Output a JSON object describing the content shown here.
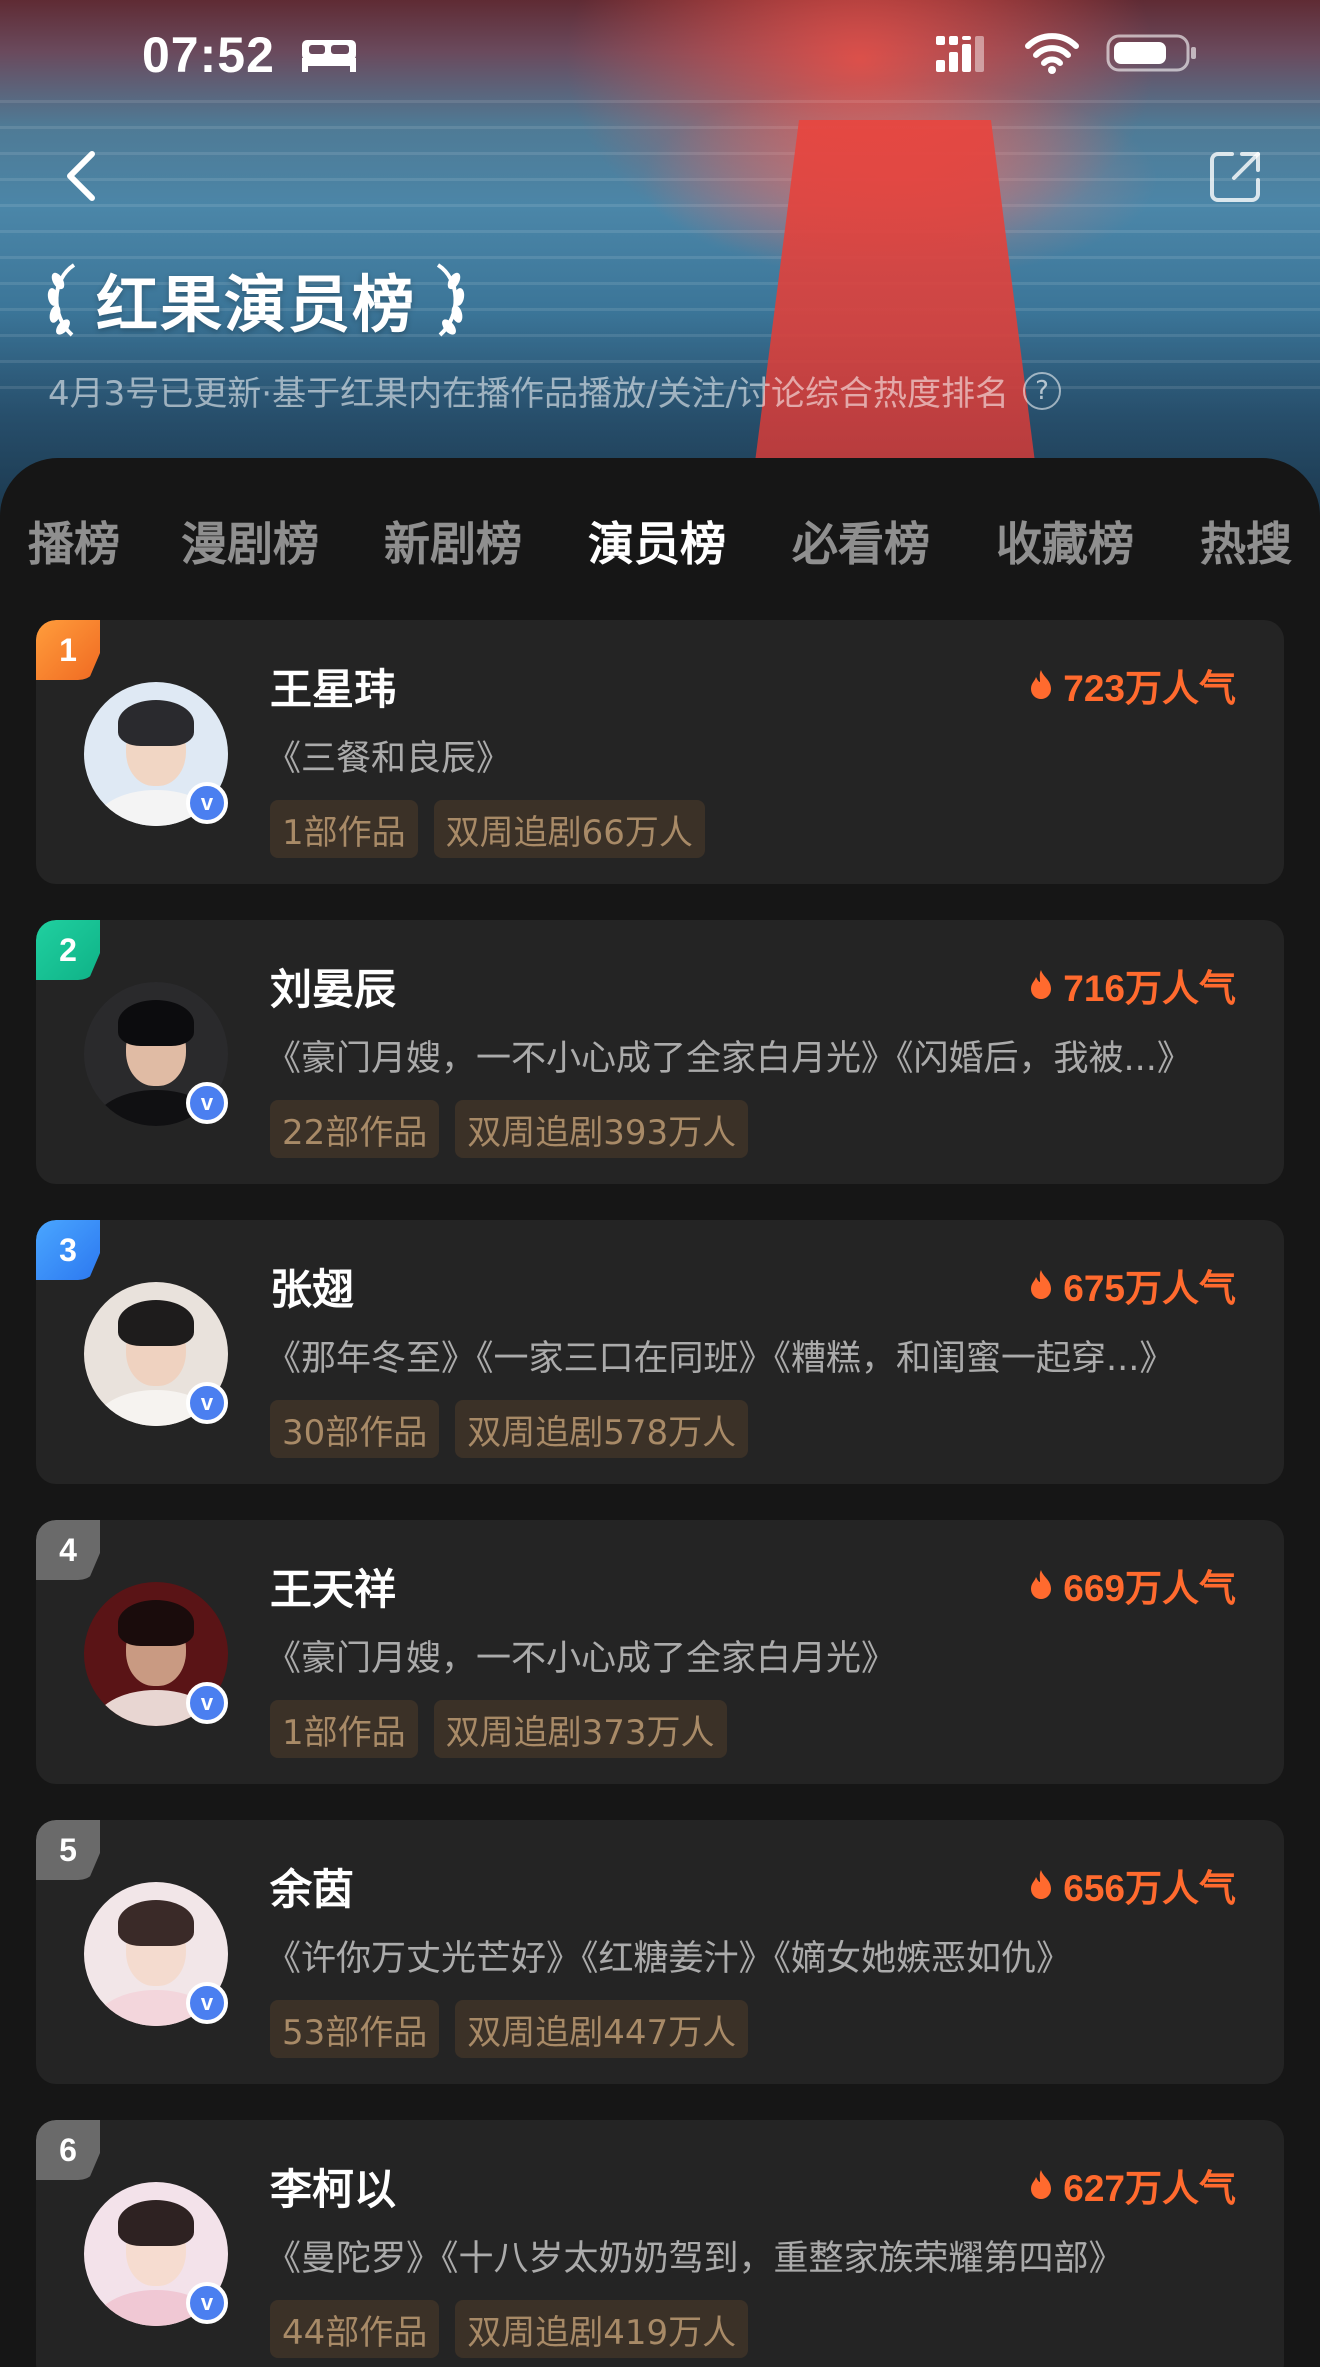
{
  "status_bar": {
    "time": "07:52"
  },
  "header": {
    "title": "红果演员榜",
    "subtitle": "4月3号已更新·基于红果内在播作品播放/关注/讨论综合热度排名",
    "help_label": "?"
  },
  "tabs": [
    {
      "label": "播榜",
      "active": false
    },
    {
      "label": "漫剧榜",
      "active": false
    },
    {
      "label": "新剧榜",
      "active": false
    },
    {
      "label": "演员榜",
      "active": true
    },
    {
      "label": "必看榜",
      "active": false
    },
    {
      "label": "收藏榜",
      "active": false
    },
    {
      "label": "热搜",
      "active": false
    }
  ],
  "verify_mark": "v",
  "colors": {
    "accent_heat": "#ff6a2e",
    "rank_1": "#f06a22",
    "rank_2": "#0fb287",
    "rank_3": "#2c78f0",
    "rank_other": "#6a6a6a",
    "tag_bg": "#3b3127",
    "tag_text": "#a88a67",
    "card_bg": "#242424",
    "page_bg": "#161616"
  },
  "actors": [
    {
      "rank": "1",
      "name": "王星玮",
      "heat": "723万人气",
      "works": "《三餐和良辰》",
      "tags": [
        "1部作品",
        "双周追剧66万人"
      ]
    },
    {
      "rank": "2",
      "name": "刘晏辰",
      "heat": "716万人气",
      "works": "《豪门月嫂，一不小心成了全家白月光》《闪婚后，我被...》",
      "tags": [
        "22部作品",
        "双周追剧393万人"
      ]
    },
    {
      "rank": "3",
      "name": "张翅",
      "heat": "675万人气",
      "works": "《那年冬至》《一家三口在同班》《糟糕，和闺蜜一起穿...》",
      "tags": [
        "30部作品",
        "双周追剧578万人"
      ]
    },
    {
      "rank": "4",
      "name": "王天祥",
      "heat": "669万人气",
      "works": "《豪门月嫂，一不小心成了全家白月光》",
      "tags": [
        "1部作品",
        "双周追剧373万人"
      ]
    },
    {
      "rank": "5",
      "name": "余茵",
      "heat": "656万人气",
      "works": "《许你万丈光芒好》《红糖姜汁》《嫡女她嫉恶如仇》",
      "tags": [
        "53部作品",
        "双周追剧447万人"
      ]
    },
    {
      "rank": "6",
      "name": "李柯以",
      "heat": "627万人气",
      "works": "《曼陀罗》《十八岁太奶奶驾到，重整家族荣耀第四部》",
      "tags": [
        "44部作品",
        "双周追剧419万人"
      ]
    }
  ]
}
